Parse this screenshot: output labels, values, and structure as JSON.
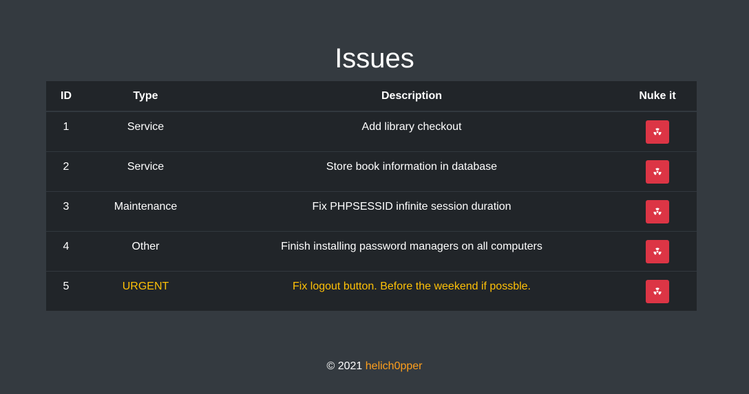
{
  "page": {
    "title": "Issues"
  },
  "table": {
    "headers": {
      "id": "ID",
      "type": "Type",
      "description": "Description",
      "action": "Nuke it"
    },
    "rows": [
      {
        "id": "1",
        "type": "Service",
        "description": "Add library checkout",
        "urgent": false
      },
      {
        "id": "2",
        "type": "Service",
        "description": "Store book information in database",
        "urgent": false
      },
      {
        "id": "3",
        "type": "Maintenance",
        "description": "Fix PHPSESSID infinite session duration",
        "urgent": false
      },
      {
        "id": "4",
        "type": "Other",
        "description": "Finish installing password managers on all computers",
        "urgent": false
      },
      {
        "id": "5",
        "type": "URGENT",
        "description": "Fix logout button. Before the weekend if possble.",
        "urgent": true
      }
    ],
    "action_icon": "radiation-icon"
  },
  "footer": {
    "copyright": "© 2021",
    "author": "helich0pper"
  },
  "colors": {
    "background": "#343a40",
    "table_background": "#212529",
    "danger": "#dc3545",
    "urgent_text": "#ffc107",
    "author_link": "#ff9f1c"
  }
}
